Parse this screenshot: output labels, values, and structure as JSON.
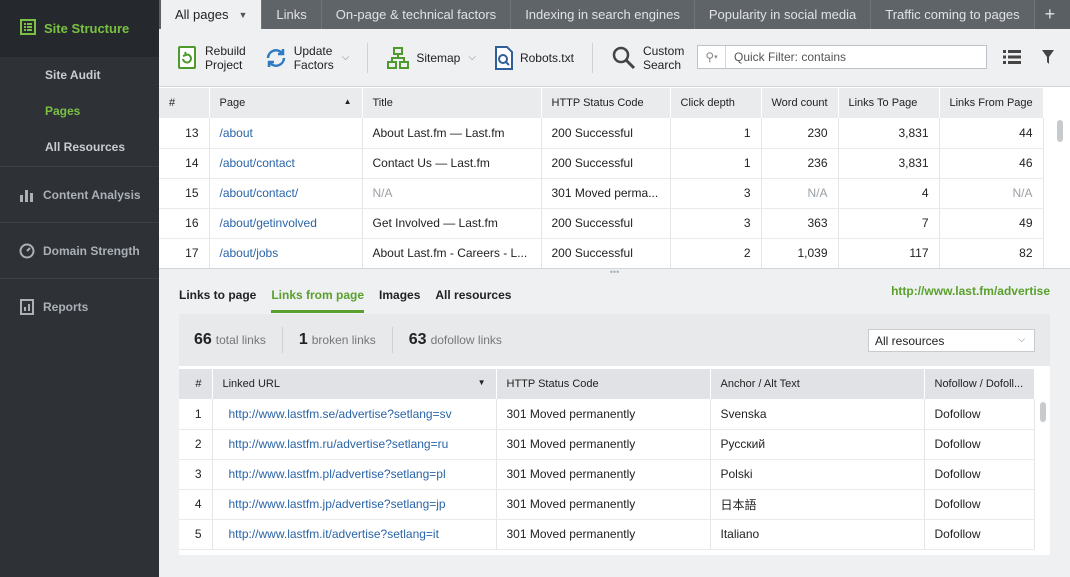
{
  "sidebar": {
    "title": "Site Structure",
    "sub_items": [
      {
        "label": "Site Audit"
      },
      {
        "label": "Pages"
      },
      {
        "label": "All Resources"
      }
    ],
    "sections": [
      {
        "label": "Content Analysis"
      },
      {
        "label": "Domain Strength"
      },
      {
        "label": "Reports"
      }
    ],
    "active_sub": "Pages"
  },
  "tabs": [
    {
      "label": "All pages"
    },
    {
      "label": "Links"
    },
    {
      "label": "On-page & technical factors"
    },
    {
      "label": "Indexing in search engines"
    },
    {
      "label": "Popularity in social media"
    },
    {
      "label": "Traffic coming to pages"
    }
  ],
  "toolbar": {
    "rebuild": "Rebuild Project",
    "rebuild_l1": "Rebuild",
    "rebuild_l2": "Project",
    "update_l1": "Update",
    "update_l2": "Factors",
    "sitemap": "Sitemap",
    "robots": "Robots.txt",
    "search_l1": "Custom",
    "search_l2": "Search",
    "quick_filter_placeholder": "Quick Filter: contains"
  },
  "pages_table": {
    "columns": [
      "#",
      "Page",
      "Title",
      "HTTP Status Code",
      "Click depth",
      "Word count",
      "Links To Page",
      "Links From Page"
    ],
    "rows": [
      {
        "n": "13",
        "page": "/about",
        "title": "About Last.fm — Last.fm",
        "status": "200 Successful",
        "depth": "1",
        "words": "230",
        "to": "3,831",
        "from": "44"
      },
      {
        "n": "14",
        "page": "/about/contact",
        "title": "Contact Us — Last.fm",
        "status": "200 Successful",
        "depth": "1",
        "words": "236",
        "to": "3,831",
        "from": "46"
      },
      {
        "n": "15",
        "page": "/about/contact/",
        "title": "N/A",
        "status": "301 Moved perma...",
        "depth": "3",
        "words": "N/A",
        "to": "4",
        "from": "N/A"
      },
      {
        "n": "16",
        "page": "/about/getinvolved",
        "title": "Get Involved — Last.fm",
        "status": "200 Successful",
        "depth": "3",
        "words": "363",
        "to": "7",
        "from": "49"
      },
      {
        "n": "17",
        "page": "/about/jobs",
        "title": "About Last.fm - Careers - L...",
        "status": "200 Successful",
        "depth": "2",
        "words": "1,039",
        "to": "117",
        "from": "82"
      }
    ]
  },
  "bottom": {
    "tabs": [
      {
        "label": "Links to page"
      },
      {
        "label": "Links from page"
      },
      {
        "label": "Images"
      },
      {
        "label": "All resources"
      }
    ],
    "active_tab": "Links from page",
    "url": "http://www.last.fm/advertise",
    "stats": [
      {
        "value": "66",
        "label": "total links"
      },
      {
        "value": "1",
        "label": "broken links"
      },
      {
        "value": "63",
        "label": "dofollow links"
      }
    ],
    "filter_selected": "All resources",
    "columns": [
      "#",
      "Linked URL",
      "HTTP Status Code",
      "Anchor / Alt Text",
      "Nofollow / Dofoll..."
    ],
    "rows": [
      {
        "n": "1",
        "url": "http://www.lastfm.se/advertise?setlang=sv",
        "status": "301 Moved permanently",
        "anchor": "Svenska",
        "follow": "Dofollow"
      },
      {
        "n": "2",
        "url": "http://www.lastfm.ru/advertise?setlang=ru",
        "status": "301 Moved permanently",
        "anchor": "Русский",
        "follow": "Dofollow"
      },
      {
        "n": "3",
        "url": "http://www.lastfm.pl/advertise?setlang=pl",
        "status": "301 Moved permanently",
        "anchor": "Polski",
        "follow": "Dofollow"
      },
      {
        "n": "4",
        "url": "http://www.lastfm.jp/advertise?setlang=jp",
        "status": "301 Moved permanently",
        "anchor": "日本語",
        "follow": "Dofollow"
      },
      {
        "n": "5",
        "url": "http://www.lastfm.it/advertise?setlang=it",
        "status": "301 Moved permanently",
        "anchor": "Italiano",
        "follow": "Dofollow"
      }
    ]
  },
  "colors": {
    "accent": "#7ac143",
    "link": "#2a64a8",
    "sidebar": "#2e3237"
  },
  "icons": {
    "site_structure": "sitemap-list-icon",
    "content": "bar-chart-icon",
    "domain": "gauge-icon",
    "reports": "report-icon"
  }
}
